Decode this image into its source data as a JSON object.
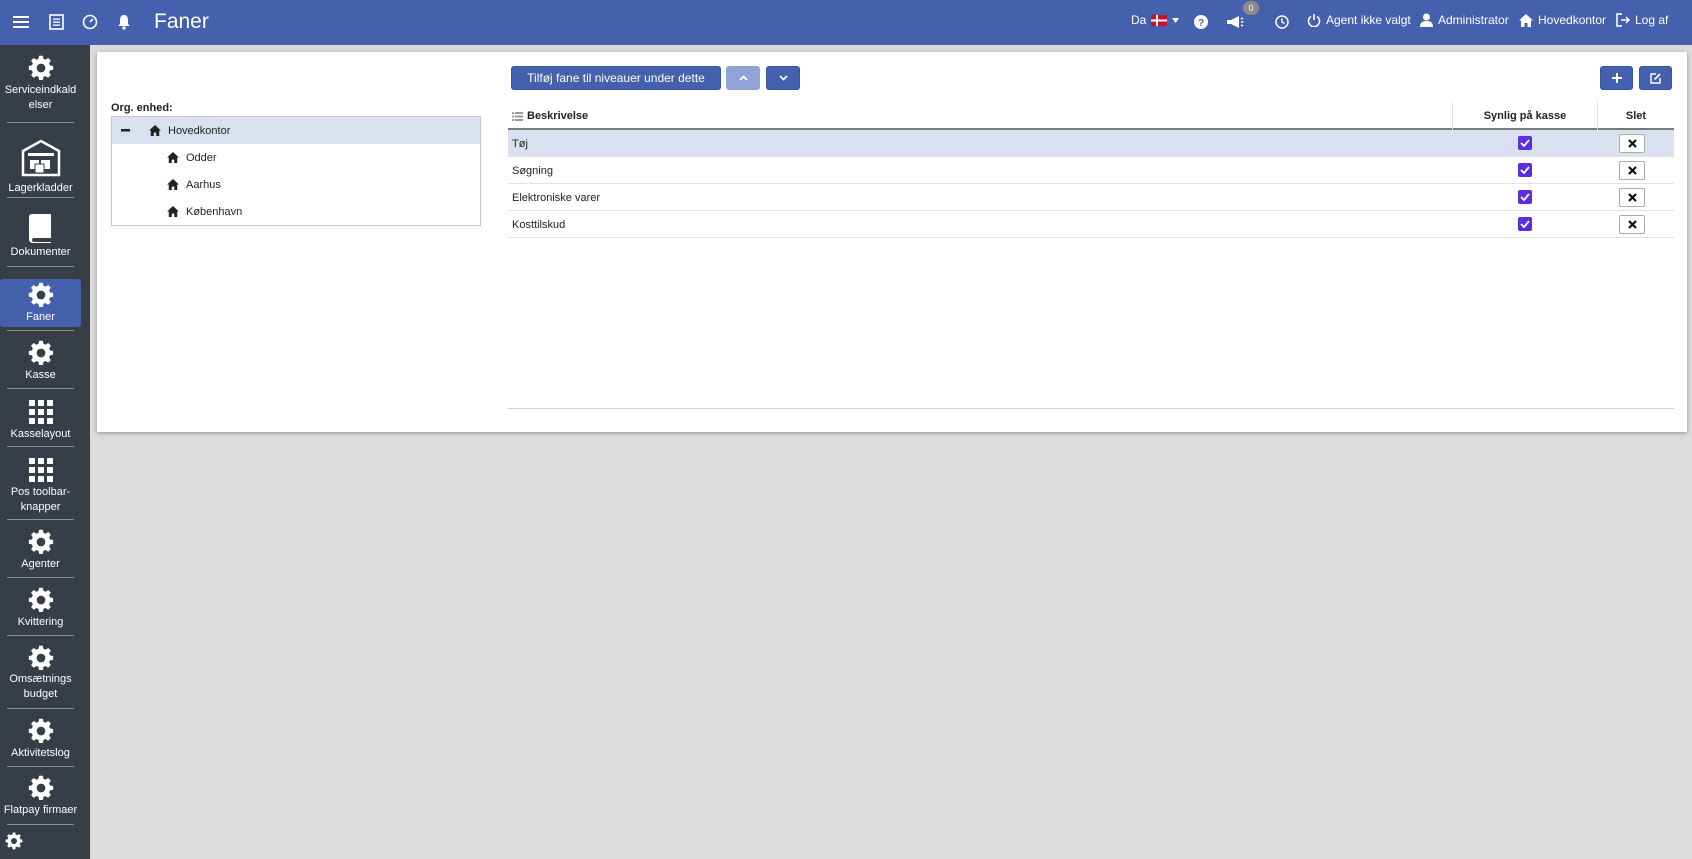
{
  "header": {
    "title": "Faner",
    "language": "Da",
    "notification_count": "0",
    "agent": "Agent ikke valgt",
    "user": "Administrator",
    "location": "Hovedkontor",
    "logout": "Log af"
  },
  "sidebar": {
    "items": [
      {
        "label": "Serviceindkald elser",
        "icon": "gear-icon"
      },
      {
        "label": "Lagerkladder",
        "icon": "warehouse-icon"
      },
      {
        "label": "Dokumenter",
        "icon": "book-icon"
      },
      {
        "label": "Faner",
        "icon": "gear-icon",
        "active": true
      },
      {
        "label": "Kasse",
        "icon": "gear-icon"
      },
      {
        "label": "Kasselayout",
        "icon": "grid-icon"
      },
      {
        "label": "Pos toolbar-knapper",
        "icon": "grid-icon"
      },
      {
        "label": "Agenter",
        "icon": "gear-icon"
      },
      {
        "label": "Kvittering",
        "icon": "gear-icon"
      },
      {
        "label": "Omsætnings budget",
        "icon": "gear-icon"
      },
      {
        "label": "Aktivitetslog",
        "icon": "gear-icon"
      },
      {
        "label": "Flatpay firmaer",
        "icon": "gear-icon"
      }
    ]
  },
  "tree": {
    "label": "Org. enhed:",
    "root": "Hovedkontor",
    "children": [
      "Odder",
      "Aarhus",
      "København"
    ]
  },
  "toolbar": {
    "add_tab_label": "Tilføj fane til niveauer under dette"
  },
  "grid": {
    "columns": {
      "description": "Beskrivelse",
      "visible": "Synlig på kasse",
      "delete": "Slet"
    },
    "rows": [
      {
        "description": "Tøj",
        "visible": true
      },
      {
        "description": "Søgning",
        "visible": true
      },
      {
        "description": "Elektroniske varer",
        "visible": true
      },
      {
        "description": "Kosttilskud",
        "visible": true
      }
    ]
  },
  "colors": {
    "brand": "#4561ad",
    "sidebar": "#373e47",
    "checkbox": "#5a2ee0",
    "selected_row": "#d9e1f1"
  }
}
